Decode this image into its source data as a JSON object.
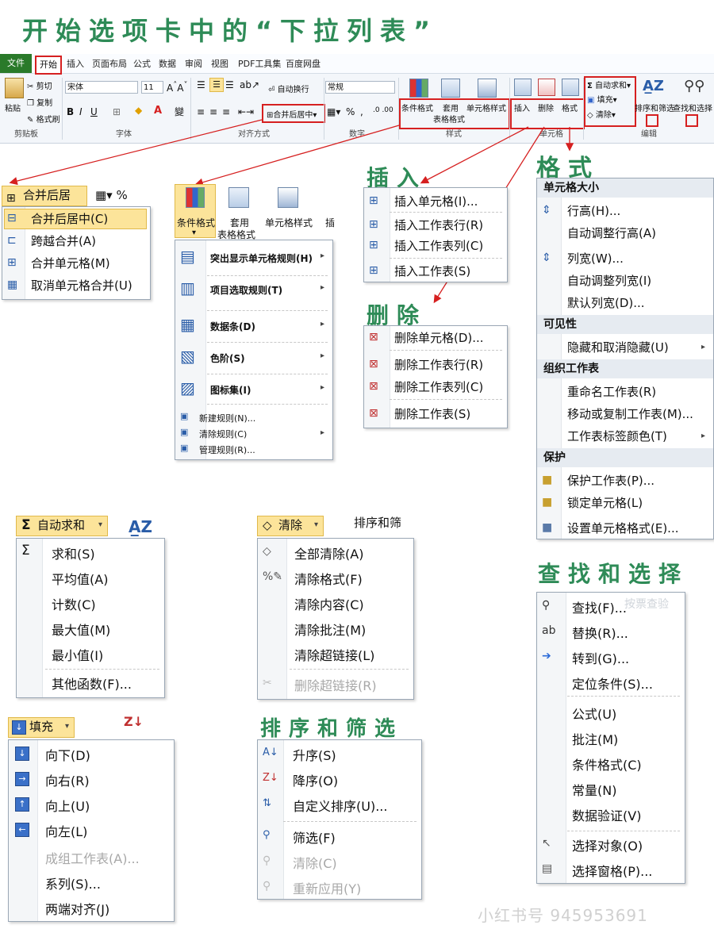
{
  "title": "开始选项卡中的“下拉列表”",
  "ribbon": {
    "file_tab": "文件",
    "home_tab": "开始",
    "tabs": [
      "插入",
      "页面布局",
      "公式",
      "数据",
      "审阅",
      "视图",
      "PDF工具集",
      "百度网盘"
    ],
    "paste": "粘贴",
    "cut": "剪切",
    "copy": "复制",
    "format_painter": "格式刷",
    "clipboard_group": "剪贴板",
    "font_name": "宋体",
    "font_size": "11",
    "font_group": "字体",
    "wrap_text": "自动换行",
    "merge_center": "合并后居中",
    "align_group": "对齐方式",
    "number_format": "常规",
    "number_group": "数字",
    "conditional_format": "条件格式",
    "table_format_1": "套用",
    "table_format_2": "表格格式",
    "cell_styles": "单元格样式",
    "styles_group": "样式",
    "insert": "插入",
    "delete": "删除",
    "format": "格式",
    "cells_group": "单元格",
    "autosum": "自动求和",
    "fill": "填充",
    "clear": "清除",
    "sort_filter": "排序和筛选",
    "find_select": "查找和选择",
    "edit_group": "编辑"
  },
  "merge_menu": {
    "button": "合并后居中",
    "items": [
      "合并后居中(C)",
      "跨越合并(A)",
      "合并单元格(M)",
      "取消单元格合并(U)"
    ]
  },
  "cf_menu": {
    "header_btn1": "条件格式",
    "header_btn2_line1": "套用",
    "header_btn2_line2": "表格格式",
    "header_btn3": "单元格样式",
    "header_btn4": "插",
    "items": [
      "突出显示单元格规则(H)",
      "项目选取规则(T)",
      "数据条(D)",
      "色阶(S)",
      "图标集(I)"
    ],
    "small_items": [
      "新建规则(N)...",
      "清除规则(C)",
      "管理规则(R)..."
    ]
  },
  "insert_section": {
    "title": "插入",
    "items": [
      "插入单元格(I)...",
      "插入工作表行(R)",
      "插入工作表列(C)",
      "插入工作表(S)"
    ]
  },
  "delete_section": {
    "title": "删除",
    "items": [
      "删除单元格(D)...",
      "删除工作表行(R)",
      "删除工作表列(C)",
      "删除工作表(S)"
    ]
  },
  "format_section": {
    "title": "格式",
    "ghost": "编辑",
    "h1": "单元格大小",
    "g1": [
      "行高(H)...",
      "自动调整行高(A)",
      "列宽(W)...",
      "自动调整列宽(I)",
      "默认列宽(D)..."
    ],
    "h2": "可见性",
    "g2": [
      "隐藏和取消隐藏(U)"
    ],
    "h3": "组织工作表",
    "g3": [
      "重命名工作表(R)",
      "移动或复制工作表(M)...",
      "工作表标签颜色(T)"
    ],
    "h4": "保护",
    "g4": [
      "保护工作表(P)...",
      "锁定单元格(L)",
      "设置单元格格式(E)..."
    ]
  },
  "autosum_menu": {
    "button": "自动求和",
    "items": [
      "求和(S)",
      "平均值(A)",
      "计数(C)",
      "最大值(M)",
      "最小值(I)",
      "其他函数(F)..."
    ]
  },
  "clear_menu": {
    "button": "清除",
    "ghost": "排序和筛",
    "items": [
      "全部清除(A)",
      "清除格式(F)",
      "清除内容(C)",
      "清除批注(M)",
      "清除超链接(L)"
    ],
    "disabled": "删除超链接(R)"
  },
  "fill_menu": {
    "button": "填充",
    "items": [
      "向下(D)",
      "向右(R)",
      "向上(U)",
      "向左(L)"
    ],
    "disabled": "成组工作表(A)...",
    "items2": [
      "系列(S)...",
      "两端对齐(J)"
    ]
  },
  "sort_section": {
    "title": "排序和筛选",
    "items": [
      "升序(S)",
      "降序(O)",
      "自定义排序(U)...",
      "筛选(F)"
    ],
    "disabled": [
      "清除(C)",
      "重新应用(Y)"
    ]
  },
  "find_section": {
    "title": "查找和选择",
    "ghost": "按票查验",
    "items": [
      "查找(F)...",
      "替换(R)...",
      "转到(G)...",
      "定位条件(S)..."
    ],
    "items2": [
      "公式(U)",
      "批注(M)",
      "条件格式(C)",
      "常量(N)",
      "数据验证(V)"
    ],
    "items3": [
      "选择对象(O)",
      "选择窗格(P)..."
    ]
  },
  "watermark": "小红书号 945953691",
  "colors": {
    "title_green": "#2e8b57",
    "highlight_red": "#d62020",
    "hover_yellow": "#fce49a"
  }
}
